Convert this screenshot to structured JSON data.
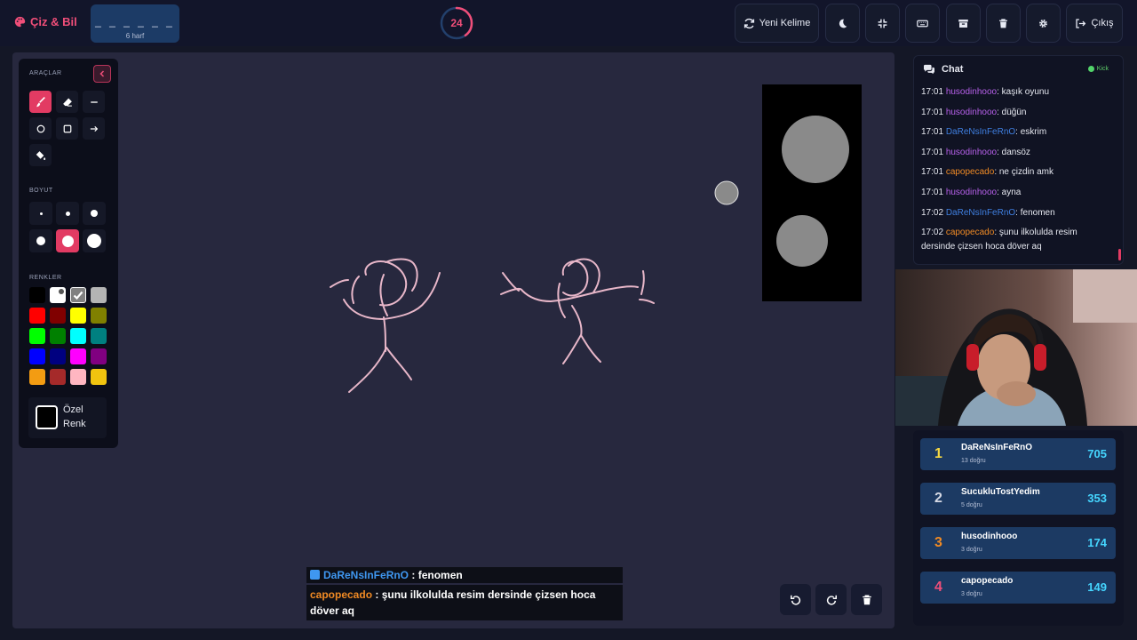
{
  "app": {
    "title": "Çiz & Bil"
  },
  "word": {
    "mask": "_ _ _ _ _ _",
    "length_label": "6 harf"
  },
  "timer": {
    "value": "24",
    "progress": 0.4
  },
  "toolbar": {
    "new_word_label": "Yeni Kelime",
    "exit_label": "Çıkış",
    "buttons": [
      {
        "icon": "refresh-icon",
        "label": "Yeni Kelime"
      },
      {
        "icon": "moon-icon"
      },
      {
        "icon": "compress-icon"
      },
      {
        "icon": "keyboard-icon"
      },
      {
        "icon": "archive-icon"
      },
      {
        "icon": "trash-icon"
      },
      {
        "icon": "gear-icon"
      },
      {
        "icon": "sign-out-icon",
        "label": "Çıkış"
      }
    ]
  },
  "tools_panel": {
    "tools_label": "ARAÇLAR",
    "size_label": "BOYUT",
    "colors_label": "RENKLER",
    "custom_color_label": "Özel Renk",
    "tools": [
      "brush-icon",
      "eraser-icon",
      "line-icon",
      "circle-icon",
      "rectangle-icon",
      "arrow-icon",
      "fill-bucket-icon"
    ],
    "active_tool": "brush-icon",
    "active_size_index": 4,
    "colors": [
      "#000000",
      "#ffffff",
      "#808080",
      "#b4b4b4",
      "#ff0000",
      "#800000",
      "#ffff00",
      "#808000",
      "#00ff00",
      "#008000",
      "#00ffff",
      "#008080",
      "#0000ff",
      "#000080",
      "#ff00ff",
      "#800080",
      "#f39c12",
      "#a52a2a",
      "#ffb6c1",
      "#f1c40f"
    ],
    "selected_color": "#808080",
    "brush_color": "#e8b7c9"
  },
  "overlay_chat": [
    {
      "user": "DaReNsInFeRnO",
      "separator": " : ",
      "text": "fenomen",
      "user_color": "#3f97f0"
    },
    {
      "user": "capopecado",
      "separator": " : ",
      "text": "şunu ilkolulda resim dersinde çizsen hoca döver aq",
      "user_color": "#f08a24"
    }
  ],
  "chat": {
    "title": "Chat",
    "platform": "Kick",
    "messages": [
      {
        "time": "17:01",
        "user": "husodinhooo",
        "text": "kaşık oyunu",
        "color": "#b760ea"
      },
      {
        "time": "17:01",
        "user": "husodinhooo",
        "text": "düğün",
        "color": "#b760ea"
      },
      {
        "time": "17:01",
        "user": "DaReNsInFeRnO",
        "text": "eskrim",
        "color": "#3f7fe0"
      },
      {
        "time": "17:01",
        "user": "husodinhooo",
        "text": "dansöz",
        "color": "#b760ea"
      },
      {
        "time": "17:01",
        "user": "capopecado",
        "text": "ne çizdin amk",
        "color": "#f08a24"
      },
      {
        "time": "17:01",
        "user": "husodinhooo",
        "text": "ayna",
        "color": "#b760ea"
      },
      {
        "time": "17:02",
        "user": "DaReNsInFeRnO",
        "text": "fenomen",
        "color": "#3f7fe0"
      },
      {
        "time": "17:02",
        "user": "capopecado",
        "text": "şunu ilkolulda resim dersinde çizsen hoca döver aq",
        "color": "#f08a24"
      }
    ]
  },
  "leaderboard": [
    {
      "rank": "1",
      "name": "DaReNsInFeRnO",
      "detail": "13 doğru",
      "score": "705",
      "rank_color": "#f5d742"
    },
    {
      "rank": "2",
      "name": "SucukluTostYedim",
      "detail": "5 doğru",
      "score": "353",
      "rank_color": "#d5d9e4"
    },
    {
      "rank": "3",
      "name": "husodinhooo",
      "detail": "3 doğru",
      "score": "174",
      "rank_color": "#f08a24"
    },
    {
      "rank": "4",
      "name": "capopecado",
      "detail": "3 doğru",
      "score": "149",
      "rank_color": "#f04e79"
    }
  ]
}
